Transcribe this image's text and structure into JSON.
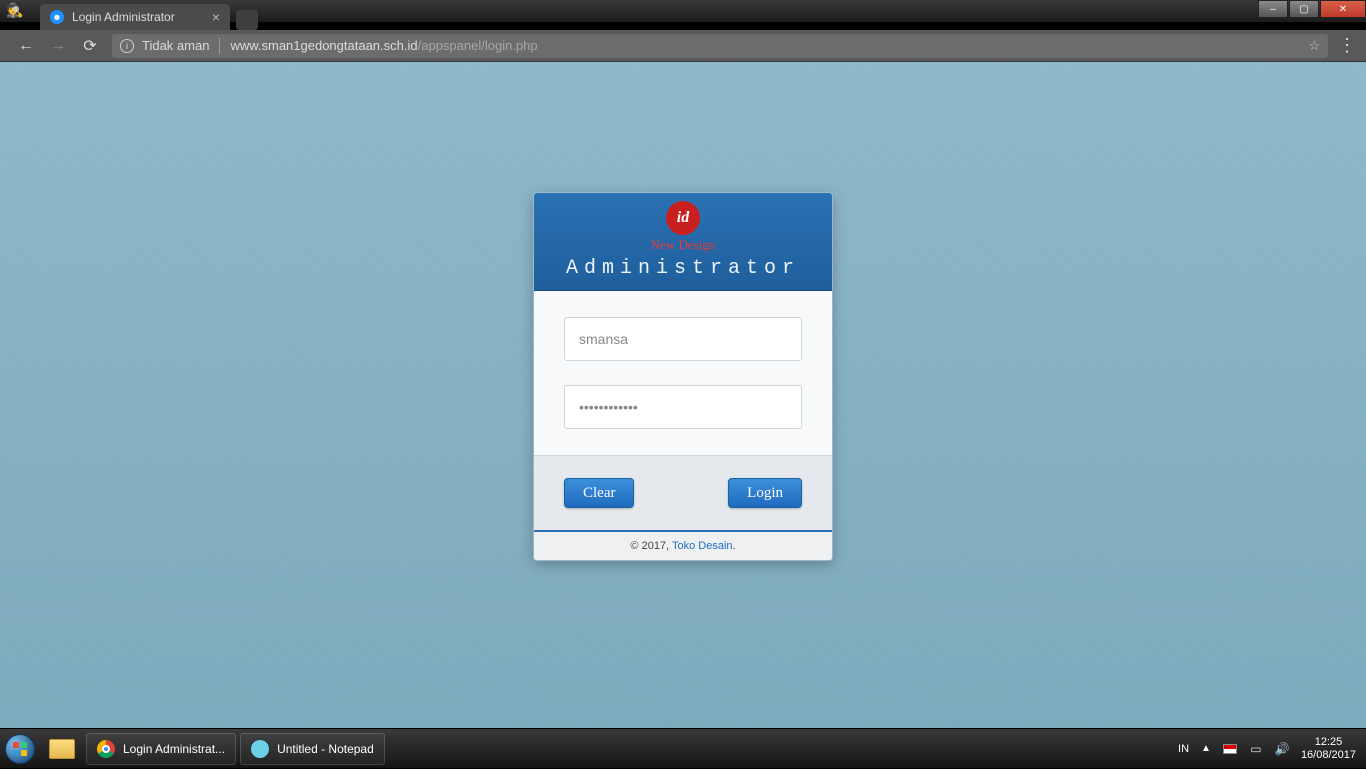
{
  "os": {
    "window_buttons": {
      "min": "–",
      "max": "▢",
      "close": "✕"
    }
  },
  "browser": {
    "incognito_icon": "🕵",
    "tab": {
      "title": "Login Administrator",
      "close": "×"
    },
    "nav": {
      "back": "←",
      "forward": "→",
      "reload": "⟳"
    },
    "address": {
      "security_label": "Tidak aman",
      "host": "www.sman1gedongtataan.sch.id",
      "path": "/appspanel/login.php",
      "star": "☆"
    },
    "menu": "⋮"
  },
  "login": {
    "logo_text": "id",
    "logo_sub": "New Design",
    "title": "Administrator",
    "username_value": "smansa",
    "password_value": "••••••••••••",
    "clear_label": "Clear",
    "login_label": "Login",
    "footer_prefix": "© 2017, ",
    "footer_link": "Toko Desain",
    "footer_suffix": "."
  },
  "taskbar": {
    "items": [
      {
        "label": "Login Administrat..."
      },
      {
        "label": "Untitled - Notepad"
      }
    ],
    "tray": {
      "lang": "IN",
      "up": "▲",
      "time": "12:25",
      "date": "16/08/2017"
    }
  }
}
